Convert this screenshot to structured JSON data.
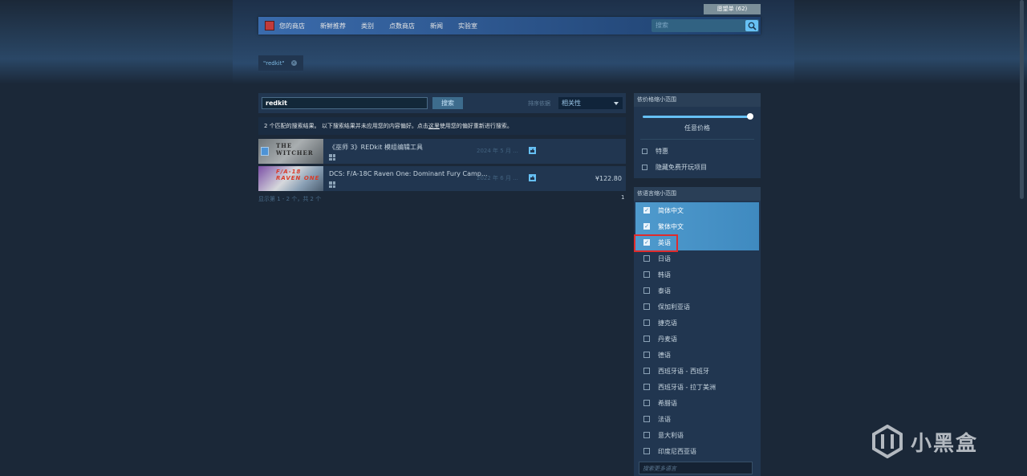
{
  "header": {
    "wishlist_label": "愿望单 (62)",
    "nav": [
      "您的商店",
      "新鲜推荐",
      "类别",
      "点数商店",
      "新闻",
      "实验室"
    ],
    "search_placeholder": "搜索"
  },
  "filter_tag": {
    "label": "\"redkit\""
  },
  "search": {
    "term": "redkit",
    "button_label": "搜索",
    "sort_label": "排序依据",
    "sort_value": "相关性"
  },
  "result_info": {
    "prefix": "2 个匹配的搜索结果。 以下搜索结果并未应用您的内容偏好。点击",
    "link": "这里",
    "suffix": "使用您的偏好重新进行搜索。"
  },
  "results": [
    {
      "thumb_text": "THE WITCHER",
      "name": "《巫师 3》REDkit 模组编辑工具",
      "date": "2024 年 5 月 ...",
      "price": ""
    },
    {
      "thumb_text": "F/A-18 RAVEN ONE",
      "name": "DCS: F/A-18C Raven One: Dominant Fury Camp...",
      "date": "2022 年 6 月 ...",
      "price": "¥122.80"
    }
  ],
  "pagination": {
    "showing": "显示第 1 - 2 个，共 2 个",
    "page": "1"
  },
  "price_filter": {
    "title": "依价格缩小范围",
    "any_price": "任意价格",
    "options": [
      "特惠",
      "隐藏免费开玩项目"
    ]
  },
  "language_filter": {
    "title": "依语言缩小范围",
    "languages": [
      {
        "name": "简体中文",
        "checked": true
      },
      {
        "name": "繁体中文",
        "checked": true
      },
      {
        "name": "英语",
        "checked": true
      },
      {
        "name": "日语",
        "checked": false
      },
      {
        "name": "韩语",
        "checked": false
      },
      {
        "name": "泰语",
        "checked": false
      },
      {
        "name": "保加利亚语",
        "checked": false
      },
      {
        "name": "捷克语",
        "checked": false
      },
      {
        "name": "丹麦语",
        "checked": false
      },
      {
        "name": "德语",
        "checked": false
      },
      {
        "name": "西班牙语 - 西班牙",
        "checked": false
      },
      {
        "name": "西班牙语 - 拉丁美洲",
        "checked": false
      },
      {
        "name": "希腊语",
        "checked": false
      },
      {
        "name": "法语",
        "checked": false
      },
      {
        "name": "意大利语",
        "checked": false
      },
      {
        "name": "印度尼西亚语",
        "checked": false
      }
    ],
    "search_placeholder": "搜索更多语言"
  },
  "watermark": {
    "text": "小黑盒"
  }
}
